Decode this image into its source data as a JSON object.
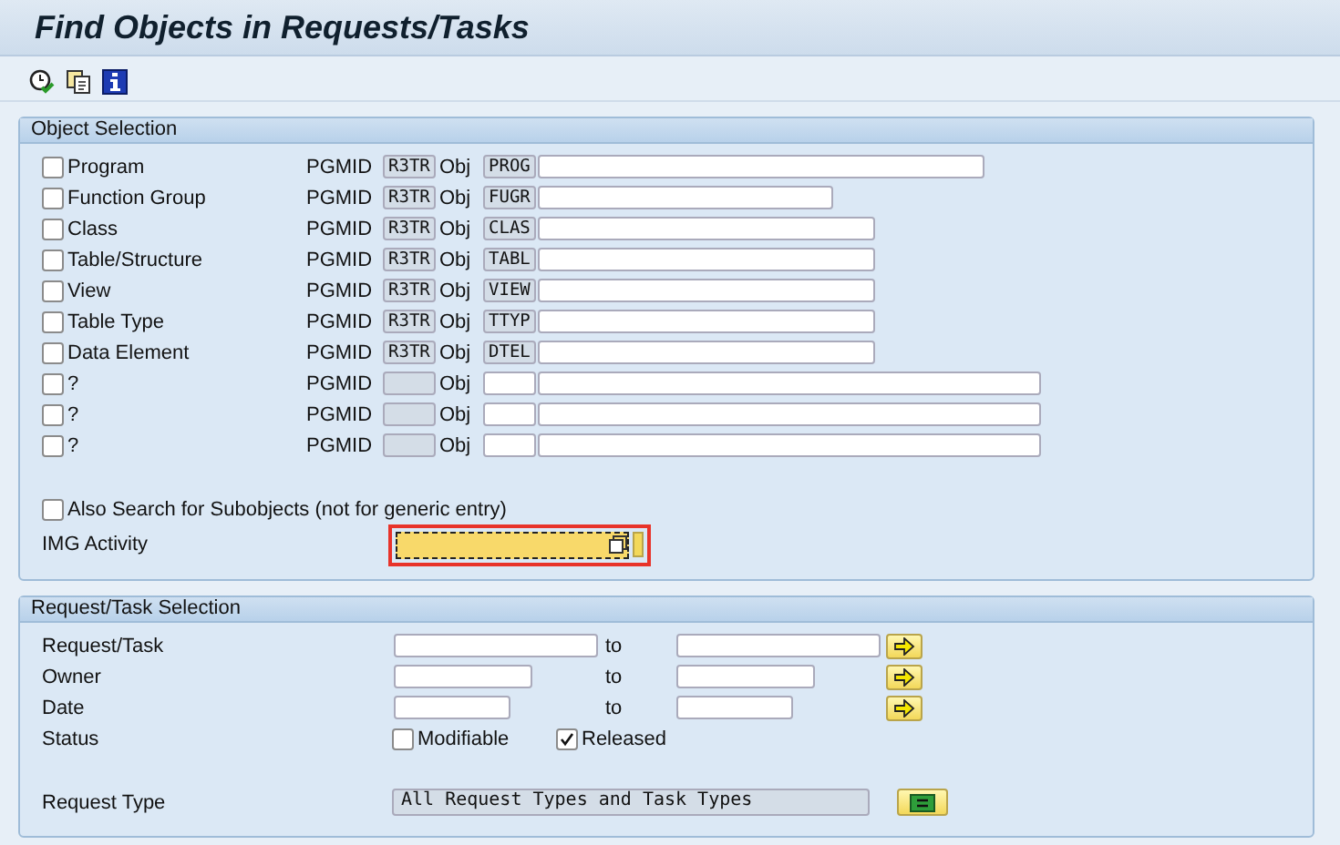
{
  "window": {
    "title": "Find Objects in Requests/Tasks"
  },
  "toolbar": {
    "buttons": [
      {
        "kind": "execute"
      },
      {
        "kind": "copy"
      },
      {
        "kind": "info"
      }
    ]
  },
  "object_selection": {
    "title": "Object Selection",
    "rows": [
      {
        "label": "Program",
        "checked": false,
        "pgmid_label": "PGMID",
        "pgmid": "R3TR",
        "obj_label": "Obj",
        "object": "PROG"
      },
      {
        "label": "Function Group",
        "checked": false,
        "pgmid_label": "PGMID",
        "pgmid": "R3TR",
        "obj_label": "Obj",
        "object": "FUGR"
      },
      {
        "label": "Class",
        "checked": false,
        "pgmid_label": "PGMID",
        "pgmid": "R3TR",
        "obj_label": "Obj",
        "object": "CLAS"
      },
      {
        "label": "Table/Structure",
        "checked": false,
        "pgmid_label": "PGMID",
        "pgmid": "R3TR",
        "obj_label": "Obj",
        "object": "TABL"
      },
      {
        "label": "View",
        "checked": false,
        "pgmid_label": "PGMID",
        "pgmid": "R3TR",
        "obj_label": "Obj",
        "object": "VIEW"
      },
      {
        "label": "Table Type",
        "checked": false,
        "pgmid_label": "PGMID",
        "pgmid": "R3TR",
        "obj_label": "Obj",
        "object": "TTYP"
      },
      {
        "label": "Data Element",
        "checked": false,
        "pgmid_label": "PGMID",
        "pgmid": "R3TR",
        "obj_label": "Obj",
        "object": "DTEL"
      },
      {
        "label": "?",
        "checked": false,
        "pgmid_label": "PGMID",
        "obj_label": "Obj"
      },
      {
        "label": "?",
        "checked": false,
        "pgmid_label": "PGMID",
        "obj_label": "Obj"
      },
      {
        "label": "?",
        "checked": false,
        "pgmid_label": "PGMID",
        "obj_label": "Obj"
      }
    ],
    "subobjects": {
      "label": "Also Search for Subobjects (not for generic entry)",
      "checked": false
    },
    "img_activity": {
      "label": "IMG Activity",
      "focused": true,
      "highlighted": true
    }
  },
  "request_selection": {
    "title": "Request/Task Selection",
    "ranges": [
      {
        "label": "Request/Task",
        "to": "to"
      },
      {
        "label": "Owner",
        "to": "to"
      },
      {
        "label": "Date",
        "to": "to"
      }
    ],
    "status": {
      "label": "Status",
      "options": [
        {
          "label": "Modifiable",
          "checked": false
        },
        {
          "label": "Released",
          "checked": true
        }
      ]
    },
    "request_type": {
      "label": "Request Type",
      "value": "All Request Types and Task Types"
    }
  }
}
